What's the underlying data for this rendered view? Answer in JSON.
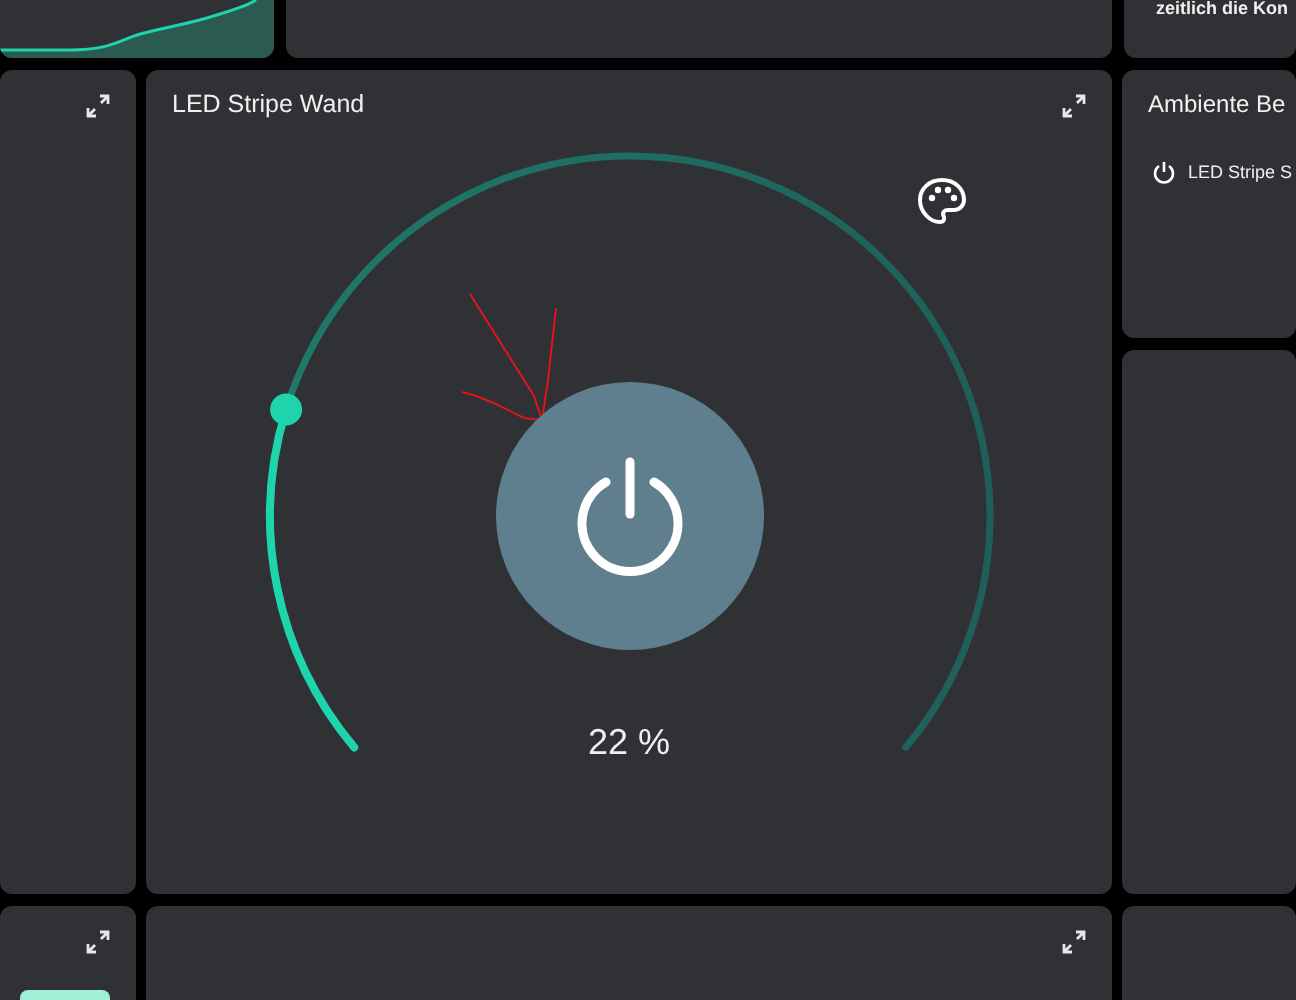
{
  "top_row": {
    "text_card": {
      "text": "zeitlich die Kon"
    }
  },
  "light_card": {
    "title": "LED Stripe Wand",
    "level": 0.22,
    "reading": "22 %"
  },
  "scene_card": {
    "title": "Ambiente Be",
    "items": [
      {
        "label": "LED Stripe S"
      }
    ]
  }
}
